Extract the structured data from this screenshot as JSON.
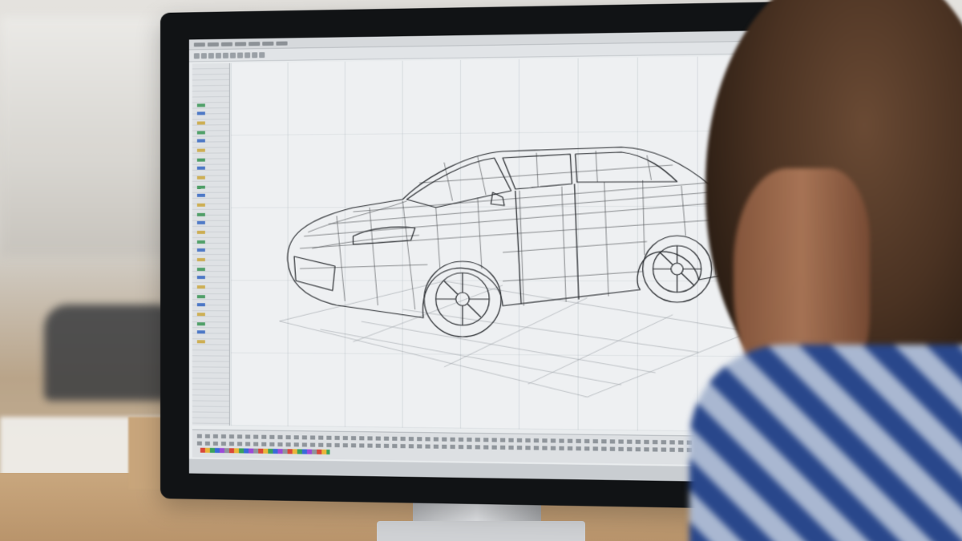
{
  "scene": {
    "subject": "wireframe-car-model",
    "colors": {
      "screen_bg": "#eef0f2",
      "wireframe": "#2a2d31",
      "bezel": "#111315",
      "desk": "#c9a77e",
      "shirt": "#2f4a82"
    }
  },
  "icons": {
    "palette": "tool-palette-icon",
    "toolbar": "toolbar-icons"
  }
}
